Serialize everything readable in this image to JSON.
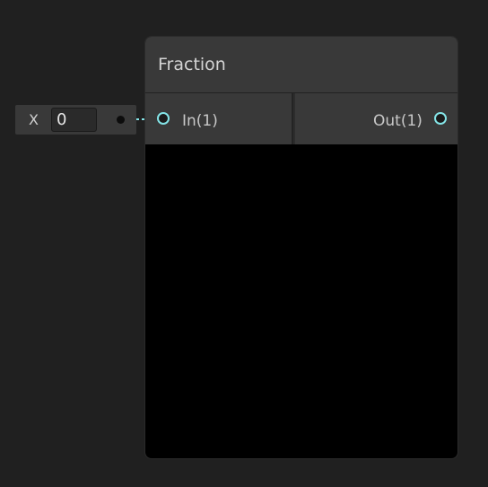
{
  "node": {
    "title": "Fraction",
    "inputs": [
      {
        "label": "In(1)"
      }
    ],
    "outputs": [
      {
        "label": "Out(1)"
      }
    ]
  },
  "inline_input": {
    "label": "X",
    "value": "0"
  },
  "colors": {
    "port_accent": "#84e4e7",
    "canvas_background": "#202020",
    "node_header": "#393939",
    "node_body": "#000000"
  },
  "icons": {
    "input_port": "port-circle-icon",
    "output_port": "port-circle-icon",
    "connector_dot": "connector-dot-icon"
  }
}
